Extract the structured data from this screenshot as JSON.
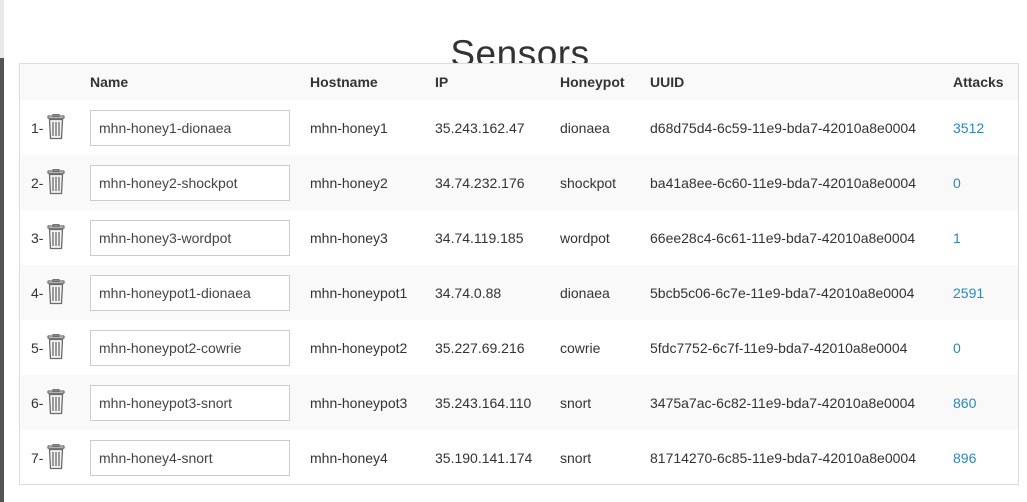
{
  "page": {
    "title": "Sensors"
  },
  "table": {
    "headers": {
      "index": "",
      "name": "Name",
      "hostname": "Hostname",
      "ip": "IP",
      "honeypot": "Honeypot",
      "uuid": "UUID",
      "attacks": "Attacks"
    },
    "rows": [
      {
        "index": "1-",
        "name": "mhn-honey1-dionaea",
        "hostname": "mhn-honey1",
        "ip": "35.243.162.47",
        "honeypot": "dionaea",
        "uuid": "d68d75d4-6c59-11e9-bda7-42010a8e0004",
        "attacks": "3512"
      },
      {
        "index": "2-",
        "name": "mhn-honey2-shockpot",
        "hostname": "mhn-honey2",
        "ip": "34.74.232.176",
        "honeypot": "shockpot",
        "uuid": "ba41a8ee-6c60-11e9-bda7-42010a8e0004",
        "attacks": "0"
      },
      {
        "index": "3-",
        "name": "mhn-honey3-wordpot",
        "hostname": "mhn-honey3",
        "ip": "34.74.119.185",
        "honeypot": "wordpot",
        "uuid": "66ee28c4-6c61-11e9-bda7-42010a8e0004",
        "attacks": "1"
      },
      {
        "index": "4-",
        "name": "mhn-honeypot1-dionaea",
        "hostname": "mhn-honeypot1",
        "ip": "34.74.0.88",
        "honeypot": "dionaea",
        "uuid": "5bcb5c06-6c7e-11e9-bda7-42010a8e0004",
        "attacks": "2591"
      },
      {
        "index": "5-",
        "name": "mhn-honeypot2-cowrie",
        "hostname": "mhn-honeypot2",
        "ip": "35.227.69.216",
        "honeypot": "cowrie",
        "uuid": "5fdc7752-6c7f-11e9-bda7-42010a8e0004",
        "attacks": "0"
      },
      {
        "index": "6-",
        "name": "mhn-honeypot3-snort",
        "hostname": "mhn-honeypot3",
        "ip": "35.243.164.110",
        "honeypot": "snort",
        "uuid": "3475a7ac-6c82-11e9-bda7-42010a8e0004",
        "attacks": "860"
      },
      {
        "index": "7-",
        "name": "mhn-honey4-snort",
        "hostname": "mhn-honey4",
        "ip": "35.190.141.174",
        "honeypot": "snort",
        "uuid": "81714270-6c85-11e9-bda7-42010a8e0004",
        "attacks": "896"
      }
    ]
  },
  "icons": {
    "delete": "trash-icon"
  },
  "colors": {
    "link": "#2e87b8",
    "row_alt": "#f9f9f9",
    "border": "#dcdcdc"
  }
}
